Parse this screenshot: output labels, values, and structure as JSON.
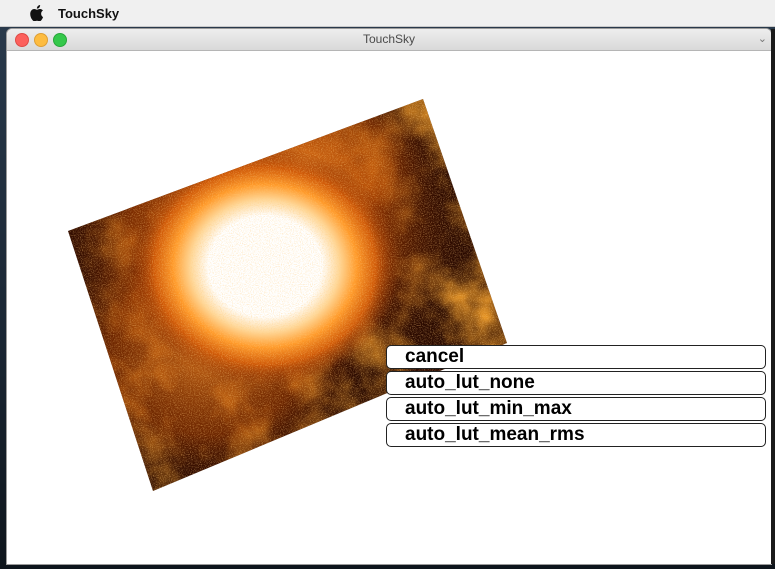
{
  "menubar": {
    "app_name": "TouchSky"
  },
  "window": {
    "title": "TouchSky",
    "edge_glyph": "⌄"
  },
  "image": {
    "description_icon": "astronomical-image",
    "colormap": [
      "#000000",
      "#5a1a00",
      "#c24a00",
      "#ff8c1a",
      "#ffd08a",
      "#ffffff"
    ]
  },
  "context_menu": {
    "items": [
      {
        "label": "cancel"
      },
      {
        "label": "auto_lut_none"
      },
      {
        "label": "auto_lut_min_max"
      },
      {
        "label": "auto_lut_mean_rms"
      }
    ]
  }
}
